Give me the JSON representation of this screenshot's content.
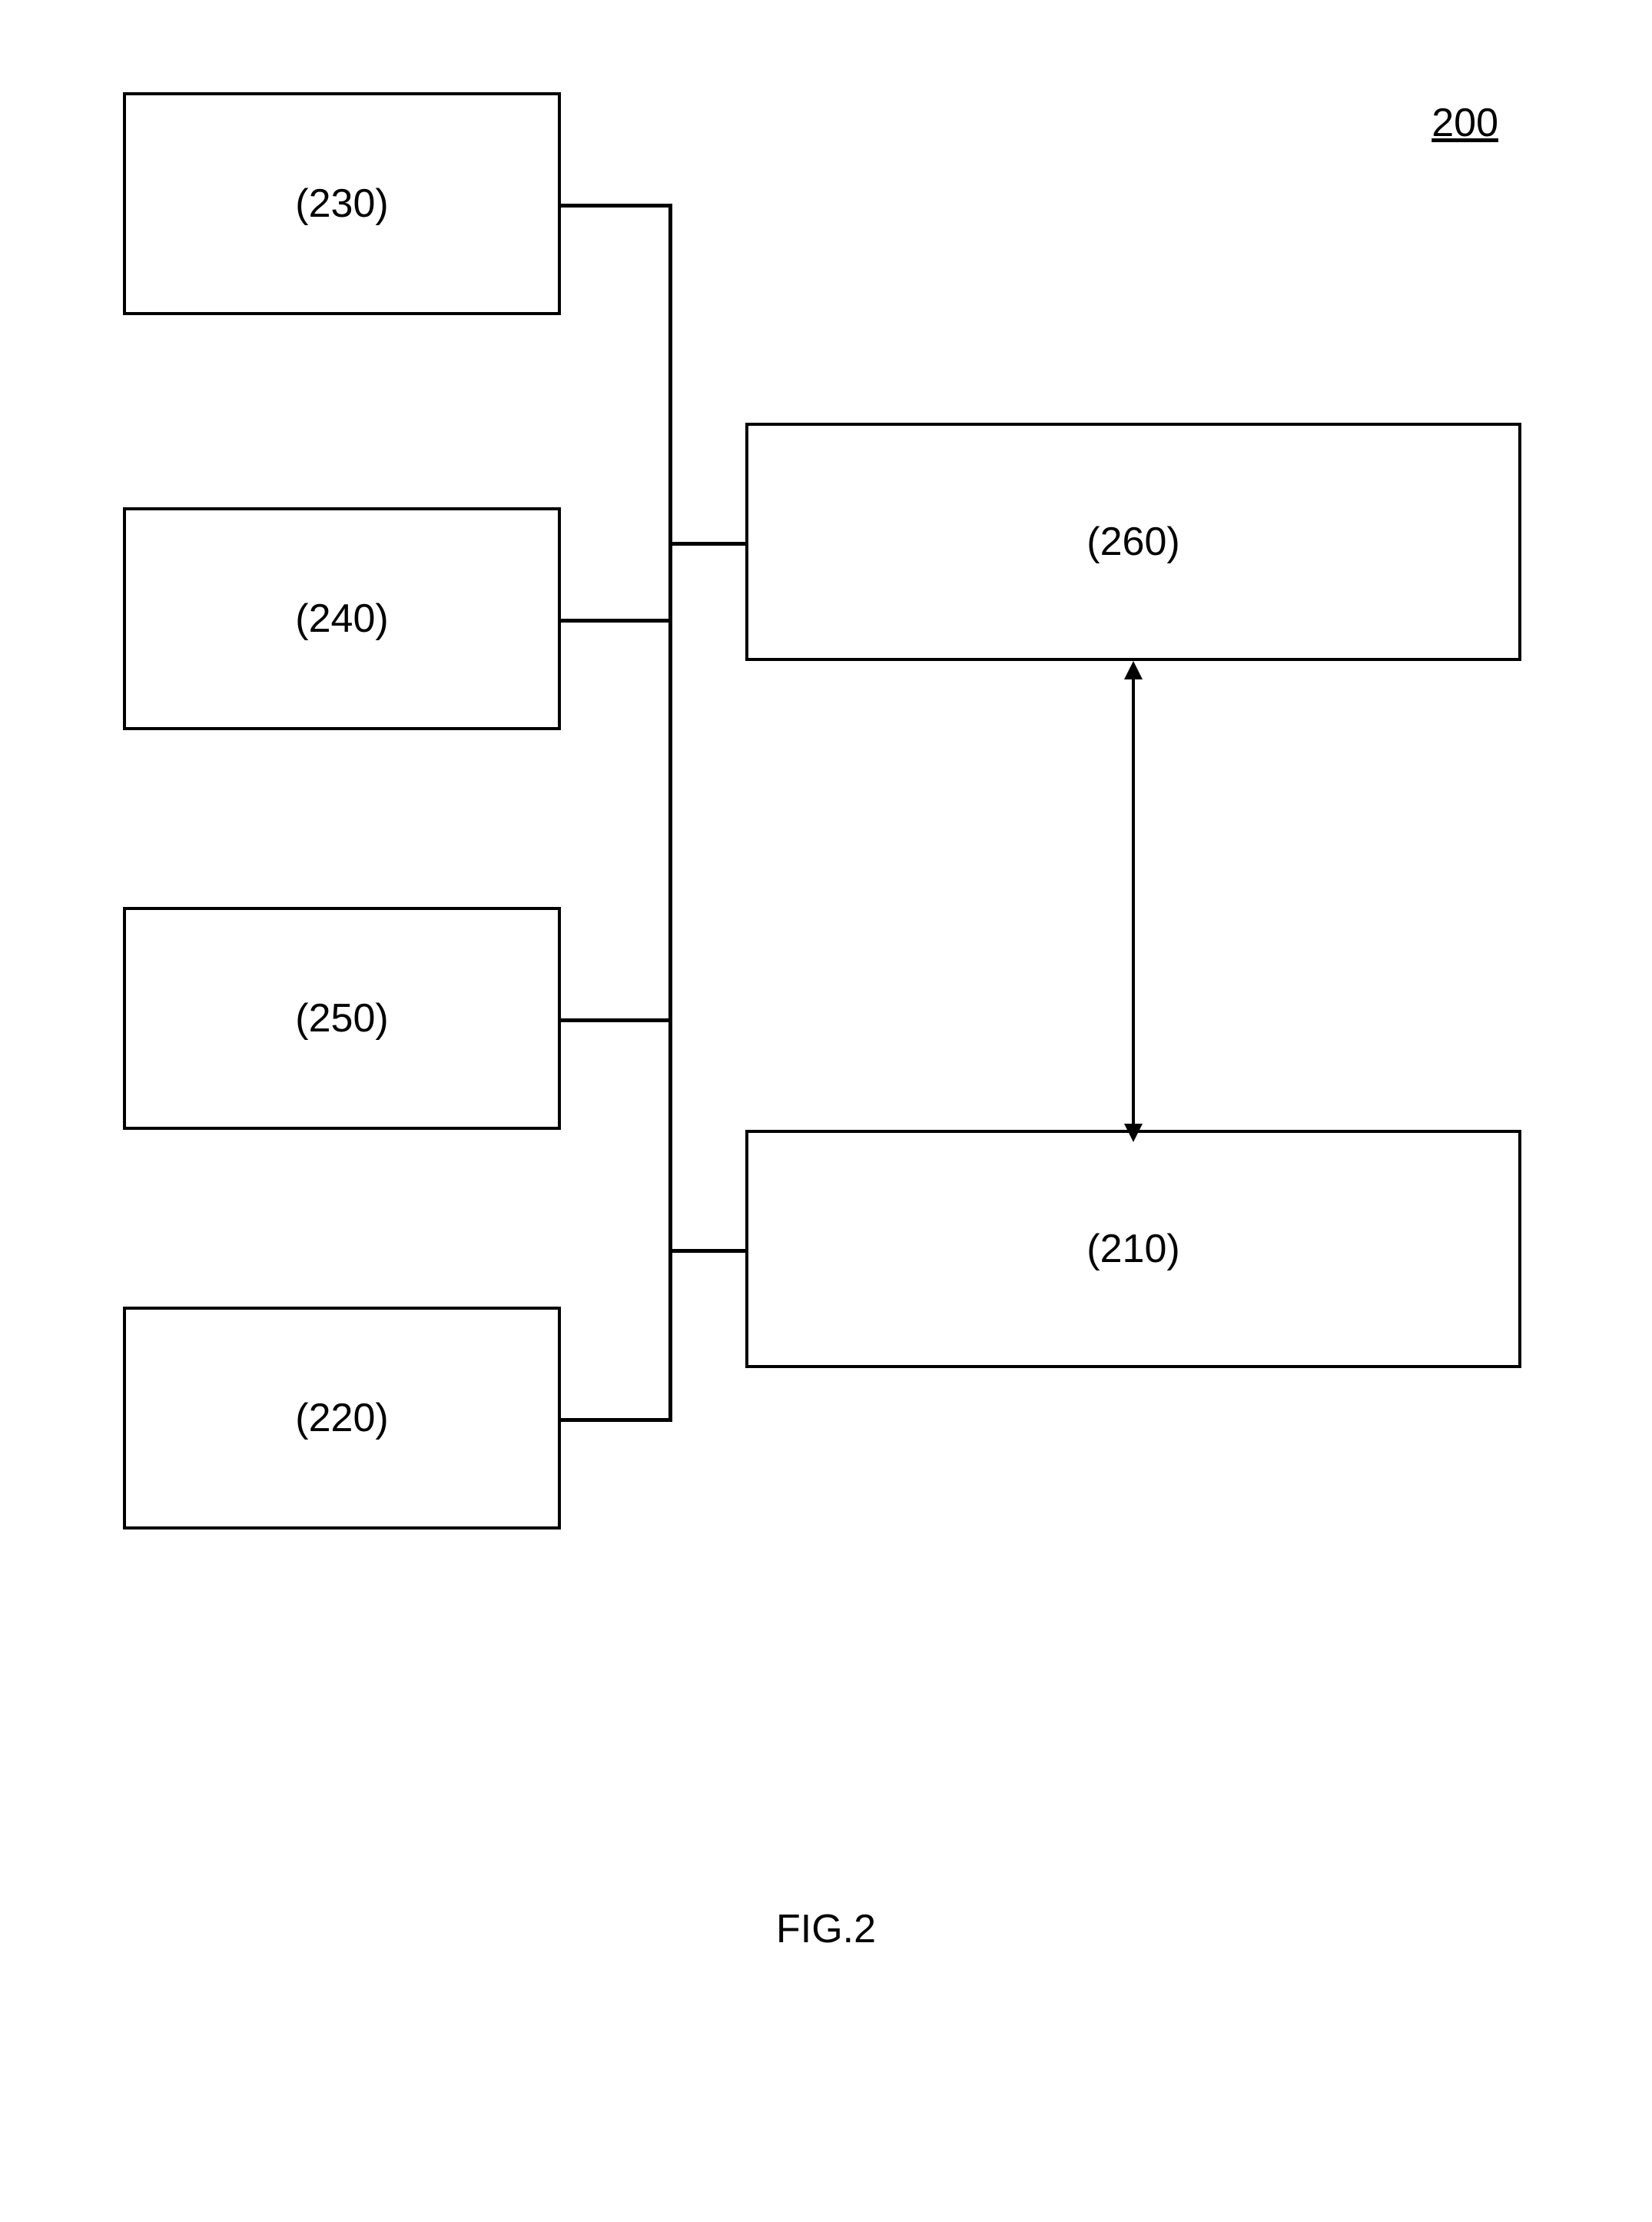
{
  "page_ref": "200",
  "figure_label": "FIG.2",
  "blocks": {
    "b230": "(230)",
    "b240": "(240)",
    "b250": "(250)",
    "b220": "(220)",
    "b260": "(260)",
    "b210": "(210)"
  }
}
